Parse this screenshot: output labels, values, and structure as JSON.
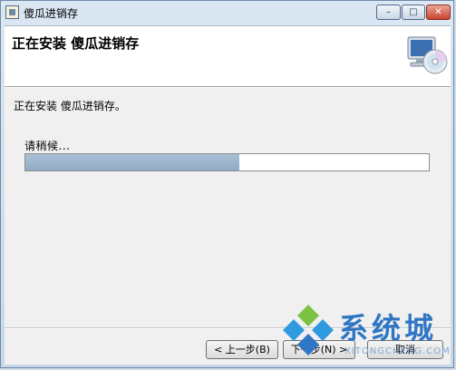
{
  "window": {
    "title": "傻瓜进销存",
    "controls": {
      "minimize_icon": "minimize-icon",
      "maximize_icon": "maximize-icon",
      "close_icon": "close-icon"
    }
  },
  "banner": {
    "title": "正在安装 傻瓜进销存",
    "icon": "computer-cd-icon"
  },
  "body": {
    "status": "正在安装 傻瓜进销存。",
    "wait_label": "请稍候...",
    "progress_fraction": 0.53
  },
  "footer": {
    "back_label": "< 上一步(B)",
    "next_label": "下一步(N) >",
    "cancel_label": "取消"
  },
  "watermark": {
    "text": "系统城",
    "url": "XITONGCHENG.COM"
  },
  "colors": {
    "progress": "#9ab3cd",
    "window_frame": "#cfdbe6",
    "watermark": "#2f76c4"
  }
}
